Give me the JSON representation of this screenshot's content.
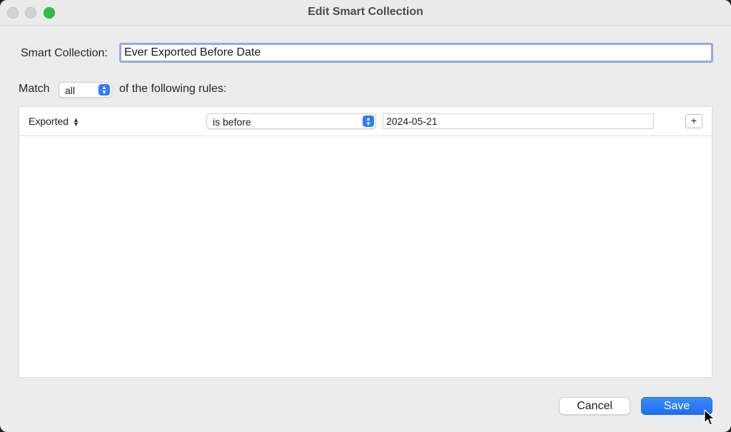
{
  "window": {
    "title": "Edit Smart Collection"
  },
  "name_field": {
    "label": "Smart Collection:",
    "value": "Ever Exported Before Date"
  },
  "match": {
    "label": "Match",
    "selected": "all",
    "suffix": "of the following rules:"
  },
  "rules": [
    {
      "field": "Exported",
      "operator": "is before",
      "value": "2024-05-21",
      "add_label": "+"
    }
  ],
  "footer": {
    "cancel_label": "Cancel",
    "save_label": "Save"
  },
  "colors": {
    "accent": "#1e6ff1",
    "focus_ring": "#8aaee8",
    "zoom_button": "#2fbf45"
  },
  "icons": {
    "window_controls": [
      "close-icon",
      "minimize-icon",
      "zoom-icon"
    ],
    "select_stepper": "chevron-updown-icon",
    "cursor": "pointer-cursor-icon"
  }
}
